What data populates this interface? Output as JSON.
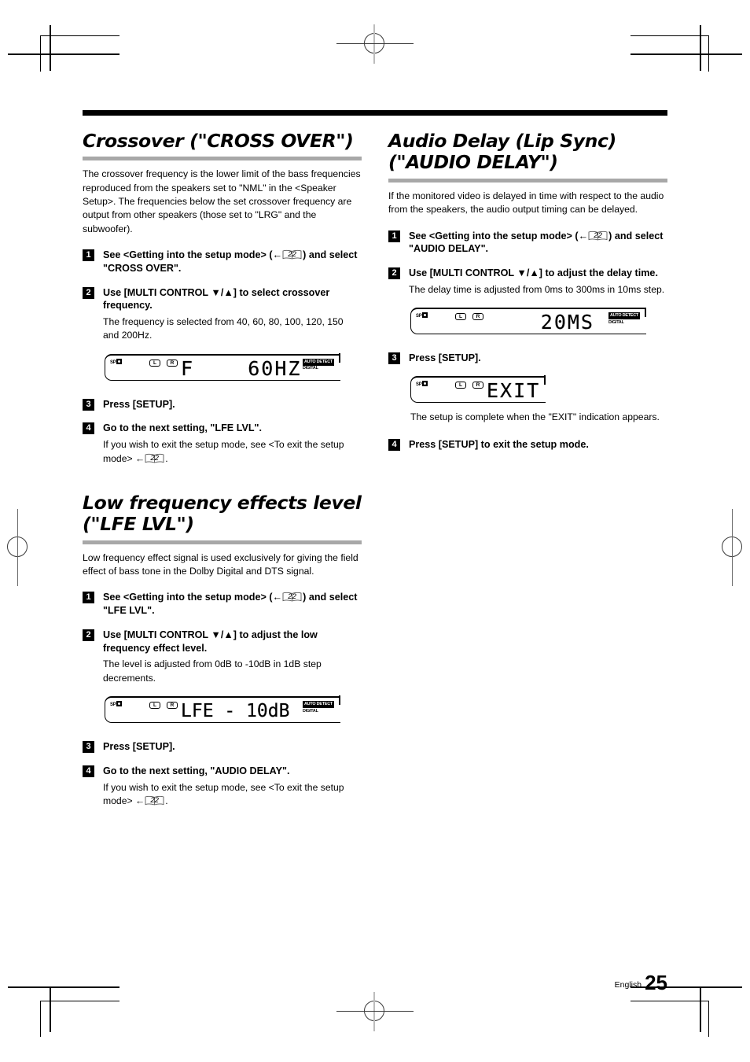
{
  "footer": {
    "language": "English",
    "page_number": "25"
  },
  "page_ref": {
    "number": "22",
    "arrow": "←"
  },
  "sections": [
    {
      "id": "crossover",
      "title": "Crossover (\"CROSS OVER\")",
      "intro": "The crossover frequency is the lower limit of the bass frequencies reproduced from the speakers set to \"NML\" in the <Speaker Setup>. The frequencies below the set crossover frequency are output from other speakers (those set to \"LRG\" and the subwoofer).",
      "steps": [
        {
          "num": "1",
          "head_pre": "See <Getting into the setup mode> (",
          "head_post": ") and select \"CROSS OVER\".",
          "body": ""
        },
        {
          "num": "2",
          "head_pre": "Use [MULTI CONTROL ▼/▲] to select crossover frequency.",
          "head_post": "",
          "body": "The frequency is selected from 40, 60, 80, 100, 120, 150 and 200Hz."
        },
        {
          "num": "3",
          "head_pre": "Press [SETUP].",
          "head_post": "",
          "body": ""
        },
        {
          "num": "4",
          "head_pre": "Go to the next setting, \"LFE LVL\".",
          "head_post": "",
          "body": "If you wish to exit the setup mode, see <To exit the setup mode> ← 22 ."
        }
      ],
      "display": {
        "sp_label": "SP",
        "left_label": "L",
        "right_label": "R",
        "segment_text": "F    60HZ",
        "badge_top": "AUTO DETECT",
        "badge_bottom": "DIGITAL"
      }
    },
    {
      "id": "lfe-lvl",
      "title": "Low frequency effects level (\"LFE LVL\")",
      "intro": "Low frequency effect signal is used exclusively for giving the field effect of bass tone in the Dolby Digital and DTS signal.",
      "steps": [
        {
          "num": "1",
          "head_pre": "See <Getting into the setup mode> (",
          "head_post": ") and select \"LFE LVL\".",
          "body": ""
        },
        {
          "num": "2",
          "head_pre": "Use [MULTI CONTROL ▼/▲] to adjust the low frequency effect level.",
          "head_post": "",
          "body": "The level is adjusted from 0dB to -10dB in 1dB step decrements."
        },
        {
          "num": "3",
          "head_pre": "Press [SETUP].",
          "head_post": "",
          "body": ""
        },
        {
          "num": "4",
          "head_pre": "Go to the next setting, \"AUDIO DELAY\".",
          "head_post": "",
          "body": "If you wish to exit the setup mode, see <To exit the setup mode> ← 22 ."
        }
      ],
      "display": {
        "sp_label": "SP",
        "left_label": "L",
        "right_label": "R",
        "segment_text": "LFE - 10dB",
        "badge_top": "AUTO DETECT",
        "badge_bottom": "DIGITAL"
      }
    },
    {
      "id": "audio-delay",
      "title": "Audio Delay (Lip Sync) (\"AUDIO DELAY\")",
      "intro": "If the monitored video is delayed in time with respect to the audio from the speakers, the audio output timing can be delayed.",
      "steps": [
        {
          "num": "1",
          "head_pre": "See <Getting into the setup mode> (",
          "head_post": ") and select \"AUDIO DELAY\".",
          "body": ""
        },
        {
          "num": "2",
          "head_pre": "Use [MULTI CONTROL ▼/▲] to adjust the delay time.",
          "head_post": "",
          "body": "The delay time is adjusted from 0ms to 300ms in 10ms step."
        },
        {
          "num": "3",
          "head_pre": "Press [SETUP].",
          "head_post": "",
          "body": ""
        },
        {
          "num": "4",
          "head_pre": "Press [SETUP] to exit the setup mode.",
          "head_post": "",
          "body": ""
        }
      ],
      "display": {
        "sp_label": "SP",
        "left_label": "L",
        "right_label": "R",
        "segment_text": "20MS",
        "badge_top": "AUTO DETECT",
        "badge_bottom": "DIGITAL"
      },
      "display2": {
        "sp_label": "SP",
        "left_label": "L",
        "right_label": "R",
        "segment_text": "EXIT"
      },
      "after_exit_note": "The setup is complete when the \"EXIT\" indication appears."
    }
  ]
}
